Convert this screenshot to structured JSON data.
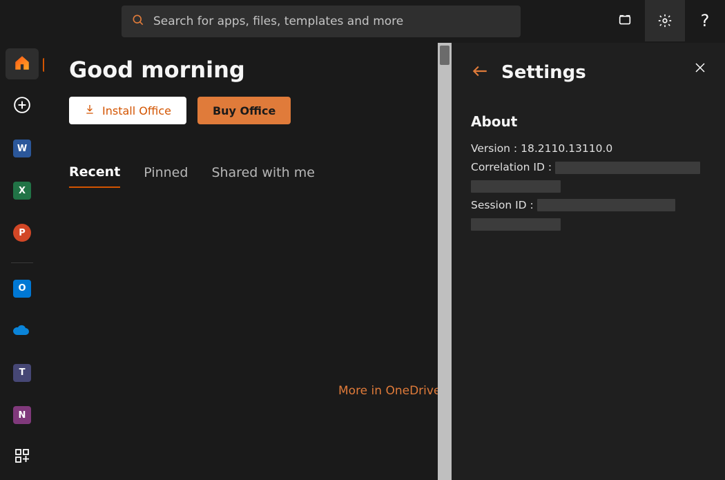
{
  "header": {
    "search_placeholder": "Search for apps, files, templates and more"
  },
  "sidebar": {
    "items": [
      {
        "name": "home",
        "label": "Home"
      },
      {
        "name": "create",
        "label": "Create"
      },
      {
        "name": "word",
        "label": "W"
      },
      {
        "name": "excel",
        "label": "X"
      },
      {
        "name": "ppt",
        "label": "P"
      },
      {
        "name": "outlook",
        "label": "O"
      },
      {
        "name": "onedrive",
        "label": "OneDrive"
      },
      {
        "name": "teams",
        "label": "T"
      },
      {
        "name": "onenote",
        "label": "N"
      },
      {
        "name": "apps",
        "label": "Apps"
      }
    ]
  },
  "main": {
    "greeting": "Good morning",
    "install_label": "Install Office",
    "buy_label": "Buy Office",
    "tabs": {
      "recent": "Recent",
      "pinned": "Pinned",
      "shared": "Shared with me"
    },
    "more_link": "More in OneDrive"
  },
  "panel": {
    "title": "Settings",
    "section_title": "About",
    "version_label": "Version :",
    "version_value": "18.2110.13110.0",
    "correlation_label": "Correlation ID :",
    "session_label": "Session ID :"
  },
  "colors": {
    "accent": "#d35400",
    "accent_light": "#e07b3a"
  }
}
